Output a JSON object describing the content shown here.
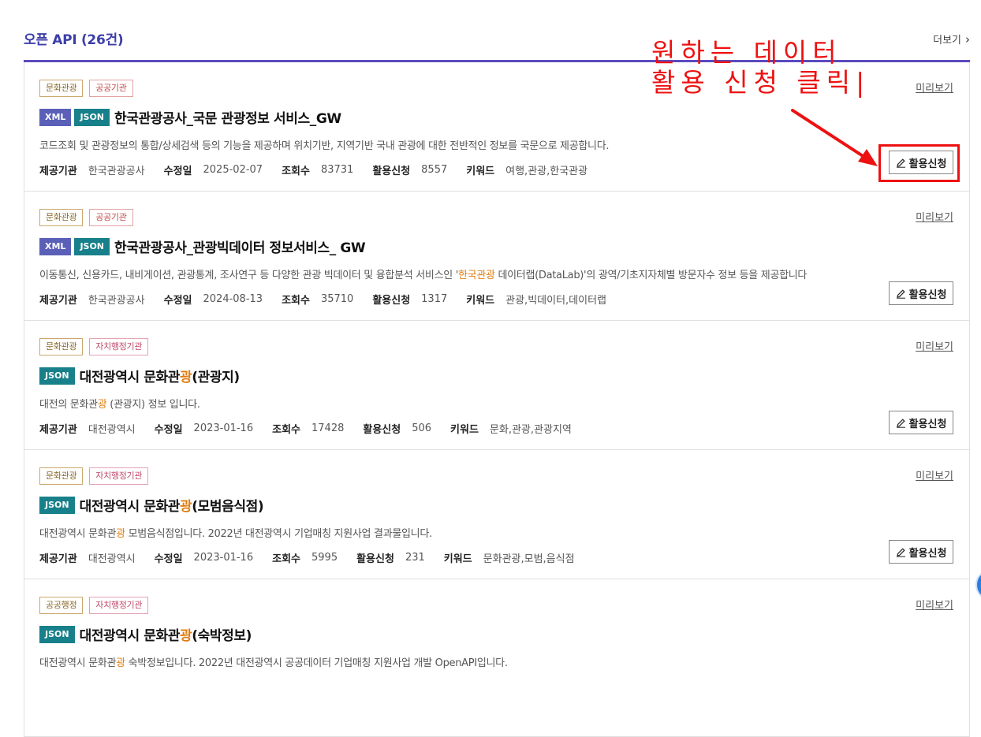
{
  "header": {
    "title": "오픈 API (26건)",
    "more": "더보기"
  },
  "annotation": {
    "line1": "원하는 데이터",
    "line2": "활용 신청 클릭|"
  },
  "labels": {
    "provider": "제공기관",
    "modified": "수정일",
    "views": "조회수",
    "applications": "활용신청",
    "keywords": "키워드",
    "preview": "미리보기",
    "apply_button": "활용신청"
  },
  "cards": [
    {
      "badges": [
        "문화관광",
        "공공기관"
      ],
      "formats": [
        "XML",
        "JSON"
      ],
      "title": [
        "한국관광공사_국문 관광정보 서비스_GW"
      ],
      "description": [
        "코드조회 및 관광정보의 통합/상세검색 등의 기능을 제공하며 위치기반, 지역기반 국내 관광에 대한 전반적인 정보를 국문으로 제공합니다."
      ],
      "provider": "한국관광공사",
      "modified": "2025-02-07",
      "views": "83731",
      "applications": "8557",
      "keywords": "여행,관광,한국관광"
    },
    {
      "badges": [
        "문화관광",
        "공공기관"
      ],
      "formats": [
        "XML",
        "JSON"
      ],
      "title": [
        "한국관광공사_관광빅데이터 정보서비스_ GW"
      ],
      "description": [
        "이동통신, 신용카드, 내비게이션, 관광통계, 조사연구 등 다양한 관광 빅데이터 및 융합분석 서비스인 '",
        "한국관광",
        " 데이터랩(DataLab)'의 광역/기초지자체별 방문자수 정보 등을 제공합니다"
      ],
      "provider": "한국관광공사",
      "modified": "2024-08-13",
      "views": "35710",
      "applications": "1317",
      "keywords": "관광,빅데이터,데이터랩"
    },
    {
      "badges": [
        "문화관광",
        "자치행정기관"
      ],
      "formats": [
        "JSON"
      ],
      "title": [
        "대전광역시 문화관",
        "광",
        "(관광지)"
      ],
      "description": [
        "대전의 문화관",
        "광",
        " (관광지) 정보 입니다."
      ],
      "provider": "대전광역시",
      "modified": "2023-01-16",
      "views": "17428",
      "applications": "506",
      "keywords": "문화,관광,관광지역"
    },
    {
      "badges": [
        "문화관광",
        "자치행정기관"
      ],
      "formats": [
        "JSON"
      ],
      "title": [
        "대전광역시 문화관",
        "광",
        "(모범음식점)"
      ],
      "description": [
        "대전광역시 문화관",
        "광",
        " 모범음식점입니다. 2022년 대전광역시 기업매칭 지원사업 결과물입니다."
      ],
      "provider": "대전광역시",
      "modified": "2023-01-16",
      "views": "5995",
      "applications": "231",
      "keywords": "문화관광,모범,음식점"
    },
    {
      "badges": [
        "공공행정",
        "자치행정기관"
      ],
      "formats": [
        "JSON"
      ],
      "title": [
        "대전광역시 문화관",
        "광",
        "(숙박정보)"
      ],
      "description": [
        "대전광역시 문화관",
        "광",
        " 숙박정보입니다. 2022년 대전광역시 공공데이터 기업매칭 지원사업 개발 OpenAPI입니다."
      ],
      "provider": "",
      "modified": "",
      "views": "",
      "applications": "",
      "keywords": ""
    }
  ],
  "colors": {
    "accent": "#5b4bbf",
    "highlight": "#e07e12",
    "annotation": "#ee1111",
    "chip_xml": "#5a5fb8",
    "chip_json": "#17808a"
  },
  "icons": {
    "more": "chevron-right-icon",
    "apply": "pencil-icon"
  }
}
